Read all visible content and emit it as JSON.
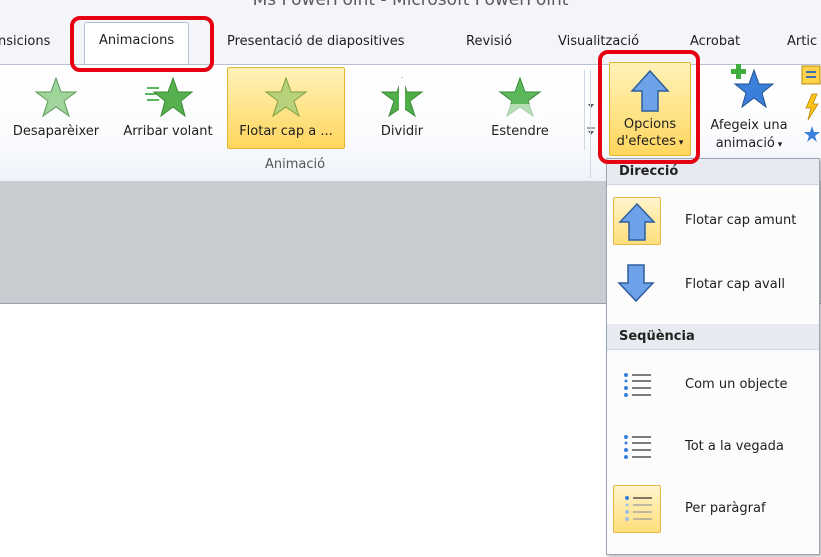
{
  "window": {
    "title": "Ms PowerPoint - Microsoft PowerPoint"
  },
  "tabs": [
    {
      "label": "nsicions"
    },
    {
      "label": "Animacions",
      "active": true
    },
    {
      "label": "Presentació de diapositives"
    },
    {
      "label": "Revisió"
    },
    {
      "label": "Visualització"
    },
    {
      "label": "Acrobat"
    },
    {
      "label": "Artic"
    }
  ],
  "ribbon": {
    "animations": [
      {
        "label": "Desaparèixer",
        "icon": "star-disappear-icon"
      },
      {
        "label": "Arribar volant",
        "icon": "star-fly-in-icon"
      },
      {
        "label": "Flotar cap a ...",
        "icon": "star-float-icon",
        "selected": true
      },
      {
        "label": "Dividir",
        "icon": "star-split-icon"
      },
      {
        "label": "Estendre",
        "icon": "star-wipe-icon"
      }
    ],
    "group_label": "Animació",
    "effect_options": {
      "line1": "Opcions",
      "line2": "d'efectes",
      "icon": "arrow-up-icon"
    },
    "add_animation": {
      "line1": "Afegeix una",
      "line2": "animació",
      "icon": "add-star-icon"
    }
  },
  "menu": {
    "direction_header": "Direcció",
    "direction_items": [
      {
        "label": "Flotar cap amunt",
        "icon": "arrow-up-icon",
        "selected": true
      },
      {
        "label": "Flotar cap avall",
        "icon": "arrow-down-icon",
        "selected": false
      }
    ],
    "sequence_header": "Seqüència",
    "sequence_items": [
      {
        "label": "Com un objecte",
        "icon": "list-bullets-icon",
        "selected": false
      },
      {
        "label": "Tot a la vegada",
        "icon": "list-bullets-icon",
        "selected": false
      },
      {
        "label": "Per paràgraf",
        "icon": "list-bullets-faded-icon",
        "selected": true
      }
    ]
  },
  "colors": {
    "accent_highlight": "#e60012",
    "selected_fill": "#ffd65e",
    "star_green": "#5cb85c",
    "arrow_blue": "#4a86d8"
  }
}
